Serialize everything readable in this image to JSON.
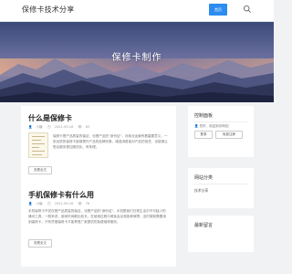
{
  "header": {
    "site_title": "保修卡技术分享",
    "nav_home": "首页"
  },
  "hero": {
    "title": "保修卡制作"
  },
  "posts": [
    {
      "title": "什么是保修卡",
      "author": "小编",
      "date": "2021-09-16",
      "views": "83",
      "excerpt": "保修卡是产品质量的保证，也是产品的\"身份证\"，对商业运营有着重要意义，一张优质的保修卡能够提升产品的品牌形象，增强消费者对产品的信任，也能够让售后服务更加规范化、有条理。",
      "read_more": "查看全文"
    },
    {
      "title": "手机保修卡有什么用",
      "author": "小编",
      "date": "2021-09-16",
      "views": "76",
      "excerpt": "手机保修卡不仅仅是产品质量的保证，也是产品的\"身份证\"。手机是我们日常生活中不可缺少的通讯工具，一般来说，使用时间都比较长，在使用过程中难免会出现各种故障，这时候就需要用到保修卡。只有凭借保修卡才能享受厂家提供的免费维修服务。",
      "read_more": "查看全文"
    }
  ],
  "sidebar": {
    "control_title": "控制面板",
    "welcome": "您好，欢迎到访网站！",
    "login": "登录",
    "register": "免费注册",
    "category_title": "网站分类",
    "category_item": "技术分享",
    "messages_title": "最新留言"
  },
  "colors": {
    "accent": "#2d8cf0",
    "background": "#f1f2f4"
  }
}
